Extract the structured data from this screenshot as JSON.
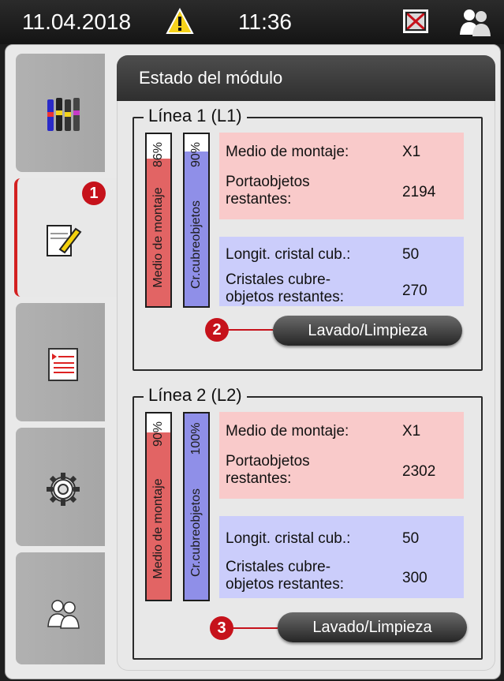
{
  "status_bar": {
    "date": "11.04.2018",
    "time": "11:36"
  },
  "sidebar": {
    "tabs": [
      "reagents",
      "module-status",
      "protocols",
      "settings",
      "user"
    ],
    "active": "module-status"
  },
  "callouts": [
    "1",
    "2",
    "3"
  ],
  "panel": {
    "title": "Estado del módulo"
  },
  "lines": [
    {
      "legend": "Línea 1 (L1)",
      "mounting_bar": {
        "label": "Medio de montaje",
        "percent_text": "86%",
        "level": 0.86,
        "color": "#e26464"
      },
      "cover_bar": {
        "label": "Cr.cubreobjetos",
        "percent_text": "90%",
        "level": 0.9,
        "color": "#8f8fe8"
      },
      "pink": [
        {
          "label": "Medio de montaje:",
          "value": "X1"
        },
        {
          "label": "Portaobjetos restantes:",
          "value": "2194"
        }
      ],
      "blue": [
        {
          "label": "Longit. cristal cub.:",
          "value": "50"
        },
        {
          "label": "Cristales cubre-objetos restantes:",
          "value": "270"
        }
      ],
      "button": "Lavado/Limpieza"
    },
    {
      "legend": "Línea 2 (L2)",
      "mounting_bar": {
        "label": "Medio de montaje",
        "percent_text": "90%",
        "level": 0.9,
        "color": "#e26464"
      },
      "cover_bar": {
        "label": "Cr.cubreobjetos",
        "percent_text": "100%",
        "level": 1.0,
        "color": "#8f8fe8"
      },
      "pink": [
        {
          "label": "Medio de montaje:",
          "value": "X1"
        },
        {
          "label": "Portaobjetos restantes:",
          "value": "2302"
        }
      ],
      "blue": [
        {
          "label": "Longit. cristal cub.:",
          "value": "50"
        },
        {
          "label": "Cristales cubre-objetos restantes:",
          "value": "300"
        }
      ],
      "button": "Lavado/Limpieza"
    }
  ]
}
